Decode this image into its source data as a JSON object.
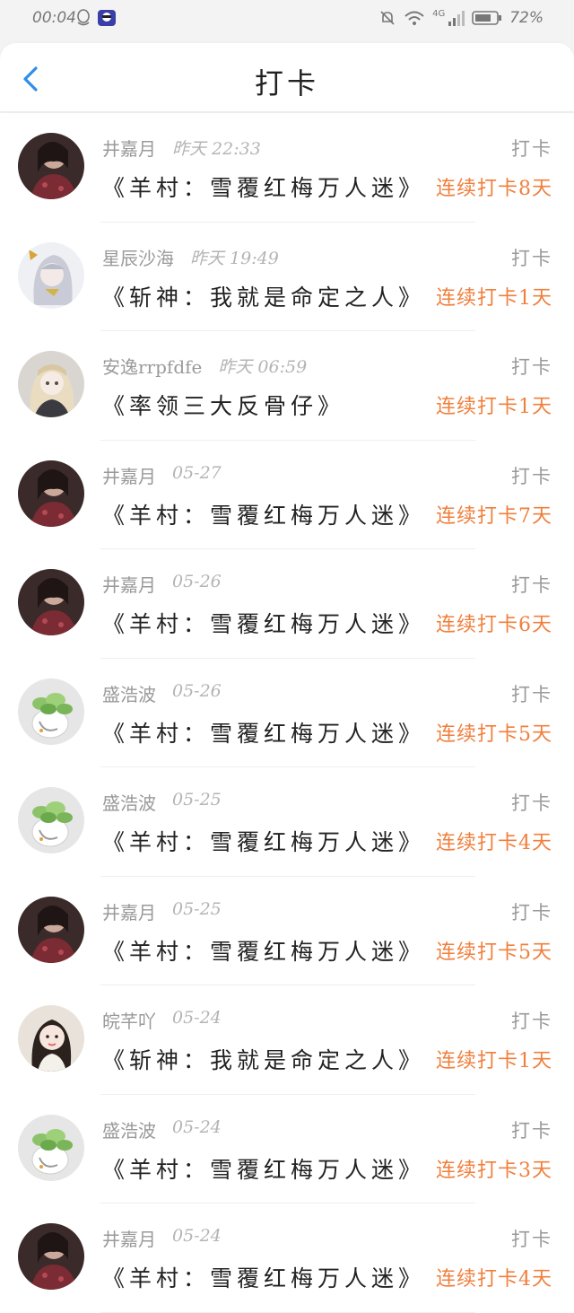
{
  "status_bar": {
    "time": "00:04",
    "battery_percent": "72%",
    "network_label": "4G"
  },
  "header": {
    "title": "打卡",
    "back_icon": "chevron-left-icon"
  },
  "colors": {
    "accent_blue": "#2f8ee8",
    "streak_orange": "#f07f3c"
  },
  "checkins": [
    {
      "user": "井嘉月",
      "time": "昨天 22:33",
      "action": "打卡",
      "book": "《羊村：雪覆红梅万人迷》",
      "streak": "连续打卡8天",
      "avatar": "dark"
    },
    {
      "user": "星辰沙海",
      "time": "昨天 19:49",
      "action": "打卡",
      "book": "《斩神：我就是命定之人》",
      "streak": "连续打卡1天",
      "avatar": "silver"
    },
    {
      "user": "安逸rrpfdfe",
      "time": "昨天 06:59",
      "action": "打卡",
      "book": "《率领三大反骨仔》",
      "streak": "连续打卡1天",
      "avatar": "blonde"
    },
    {
      "user": "井嘉月",
      "time": "05-27",
      "action": "打卡",
      "book": "《羊村：雪覆红梅万人迷》",
      "streak": "连续打卡7天",
      "avatar": "dark"
    },
    {
      "user": "井嘉月",
      "time": "05-26",
      "action": "打卡",
      "book": "《羊村：雪覆红梅万人迷》",
      "streak": "连续打卡6天",
      "avatar": "dark"
    },
    {
      "user": "盛浩波",
      "time": "05-26",
      "action": "打卡",
      "book": "《羊村：雪覆红梅万人迷》",
      "streak": "连续打卡5天",
      "avatar": "plant"
    },
    {
      "user": "盛浩波",
      "time": "05-25",
      "action": "打卡",
      "book": "《羊村：雪覆红梅万人迷》",
      "streak": "连续打卡4天",
      "avatar": "plant"
    },
    {
      "user": "井嘉月",
      "time": "05-25",
      "action": "打卡",
      "book": "《羊村：雪覆红梅万人迷》",
      "streak": "连续打卡5天",
      "avatar": "dark"
    },
    {
      "user": "皖芊吖",
      "time": "05-24",
      "action": "打卡",
      "book": "《斩神：我就是命定之人》",
      "streak": "连续打卡1天",
      "avatar": "girl"
    },
    {
      "user": "盛浩波",
      "time": "05-24",
      "action": "打卡",
      "book": "《羊村：雪覆红梅万人迷》",
      "streak": "连续打卡3天",
      "avatar": "plant"
    },
    {
      "user": "井嘉月",
      "time": "05-24",
      "action": "打卡",
      "book": "《羊村：雪覆红梅万人迷》",
      "streak": "连续打卡4天",
      "avatar": "dark"
    }
  ]
}
